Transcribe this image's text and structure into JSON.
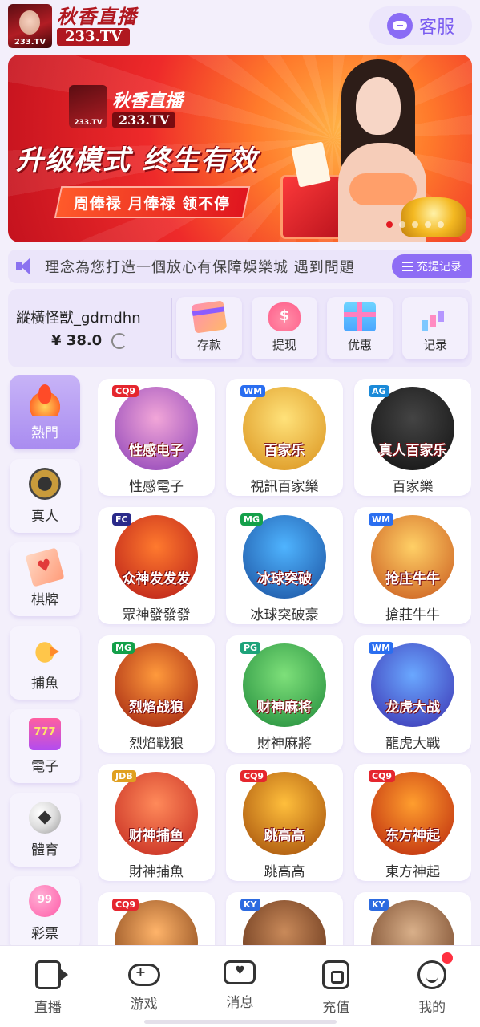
{
  "header": {
    "logo_cn": "秋香直播",
    "logo_en": "233.TV",
    "logo_icon_text": "233.TV",
    "service_label": "客服"
  },
  "banner": {
    "logo_cn": "秋香直播",
    "logo_en": "233.TV",
    "logo_icon_text": "233.TV",
    "headline": "升级模式 终生有效",
    "subline": "周俸禄 月俸禄 领不停",
    "dots": 5,
    "active_dot": 0
  },
  "marquee": {
    "text": "理念為您打造一個放心有保障娛樂城  遇到問題",
    "record_button": "充提记录"
  },
  "account": {
    "username": "縱橫怪獸_gdmdhn",
    "balance": "¥ 38.0",
    "actions": [
      {
        "label": "存款",
        "icon": "card-icon"
      },
      {
        "label": "提现",
        "icon": "money-bag-icon"
      },
      {
        "label": "优惠",
        "icon": "gift-icon"
      },
      {
        "label": "记录",
        "icon": "bar-chart-icon"
      }
    ]
  },
  "categories": [
    {
      "label": "熱門",
      "icon": "fire-icon",
      "active": true
    },
    {
      "label": "真人",
      "icon": "chip-icon",
      "active": false
    },
    {
      "label": "棋牌",
      "icon": "cards-icon",
      "active": false
    },
    {
      "label": "捕魚",
      "icon": "fish-icon",
      "active": false
    },
    {
      "label": "電子",
      "icon": "slot-icon",
      "active": false
    },
    {
      "label": "體育",
      "icon": "soccer-ball-icon",
      "active": false
    },
    {
      "label": "彩票",
      "icon": "lottery-ball-icon",
      "active": false
    }
  ],
  "games": [
    {
      "name": "性感電子",
      "art_label": "性感电子",
      "provider": "CQ9",
      "colors": [
        "#f2a6d8",
        "#8a3fb7"
      ]
    },
    {
      "name": "視訊百家樂",
      "art_label": "百家乐",
      "provider": "WM",
      "colors": [
        "#ffe27a",
        "#d9901a"
      ]
    },
    {
      "name": "百家樂",
      "art_label": "真人百家乐",
      "provider": "AG",
      "colors": [
        "#444444",
        "#111111"
      ]
    },
    {
      "name": "眾神發發發",
      "art_label": "众神发发发",
      "provider": "FC",
      "colors": [
        "#ff7a2e",
        "#b61a18"
      ]
    },
    {
      "name": "冰球突破豪",
      "art_label": "冰球突破",
      "provider": "MG",
      "colors": [
        "#4fb4ff",
        "#1a4f9e"
      ]
    },
    {
      "name": "搶莊牛牛",
      "art_label": "抢庄牛牛",
      "provider": "WM",
      "colors": [
        "#ffd066",
        "#c8571c"
      ]
    },
    {
      "name": "烈焰戰狼",
      "art_label": "烈焰战狼",
      "provider": "MG",
      "colors": [
        "#ff9a3c",
        "#9e1e0e"
      ]
    },
    {
      "name": "財神麻將",
      "art_label": "财神麻将",
      "provider": "PG",
      "colors": [
        "#7ee07a",
        "#1f8a3a"
      ]
    },
    {
      "name": "龍虎大戰",
      "art_label": "龙虎大战",
      "provider": "WM",
      "colors": [
        "#6aa8ff",
        "#3a2fb0"
      ]
    },
    {
      "name": "財神捕魚",
      "art_label": "财神捕鱼",
      "provider": "JDB",
      "colors": [
        "#ff8a5a",
        "#c2261e"
      ]
    },
    {
      "name": "跳高高",
      "art_label": "跳高高",
      "provider": "CQ9",
      "colors": [
        "#ffbf3c",
        "#a04a08"
      ]
    },
    {
      "name": "東方神起",
      "art_label": "东方神起",
      "provider": "CQ9",
      "colors": [
        "#ff9e2e",
        "#b8230c"
      ]
    },
    {
      "name": "",
      "art_label": "",
      "provider": "CQ9",
      "colors": [
        "#ffb46a",
        "#7a3a12"
      ]
    },
    {
      "name": "",
      "art_label": "",
      "provider": "KY",
      "colors": [
        "#c98a5a",
        "#5a2a12"
      ]
    },
    {
      "name": "",
      "art_label": "",
      "provider": "KY",
      "colors": [
        "#d9b08a",
        "#6a3a1e"
      ]
    }
  ],
  "bottom_nav": [
    {
      "label": "直播",
      "icon": "video-camera-icon"
    },
    {
      "label": "游戏",
      "icon": "gamepad-icon"
    },
    {
      "label": "消息",
      "icon": "message-icon"
    },
    {
      "label": "充值",
      "icon": "wallet-icon"
    },
    {
      "label": "我的",
      "icon": "profile-icon",
      "badge": true
    }
  ],
  "theme": {
    "accent": "#8e6df5",
    "background": "#f3effb",
    "banner_red": "#e0161f"
  }
}
